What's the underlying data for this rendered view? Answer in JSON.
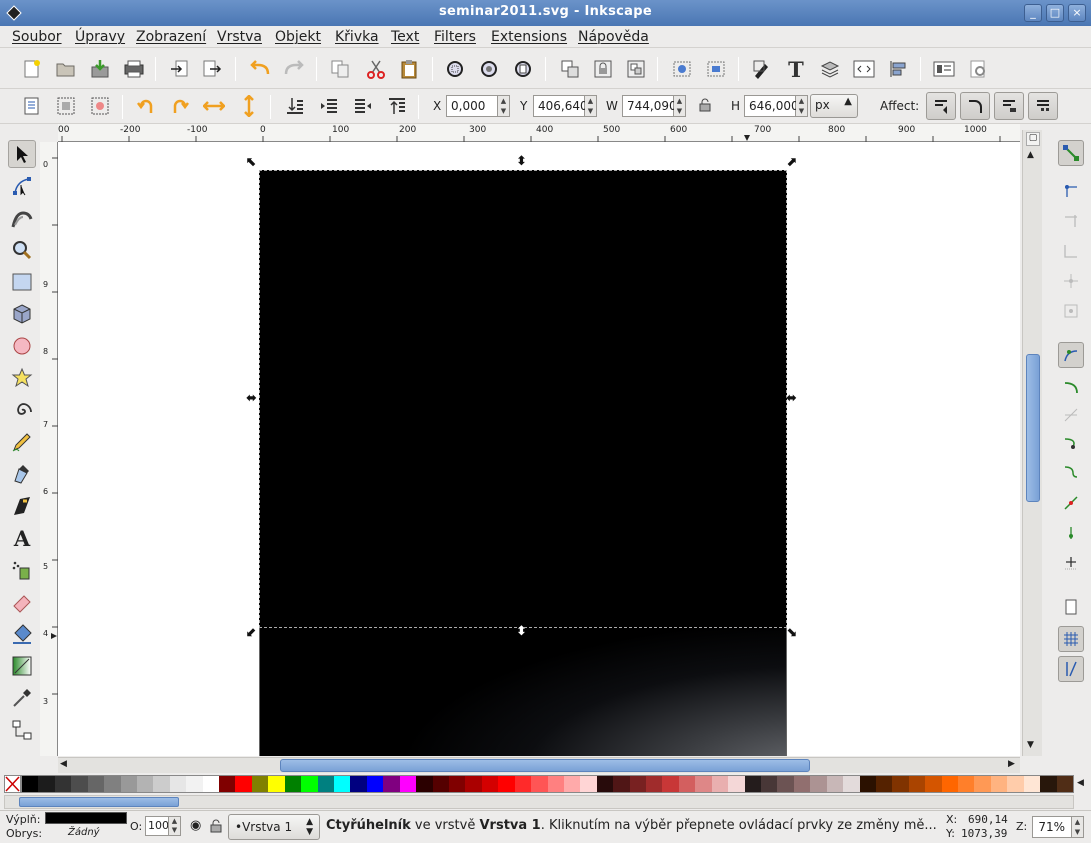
{
  "window": {
    "title": "seminar2011.svg - Inkscape",
    "btn_min": "_",
    "btn_max": "□",
    "btn_close": "×"
  },
  "menu": [
    "Soubor",
    "Úpravy",
    "Zobrazení",
    "Vrstva",
    "Objekt",
    "Křivka",
    "Text",
    "Filters",
    "Extensions",
    "Nápověda"
  ],
  "toolcontrols": {
    "x_label": "X",
    "x_value": "0,000",
    "y_label": "Y",
    "y_value": "406,640",
    "w_label": "W",
    "w_value": "744,090",
    "h_label": "H",
    "h_value": "646,000",
    "unit": "px",
    "affect_label": "Affect:"
  },
  "ruler": {
    "h_ticks": [
      "00",
      "-200",
      "-100",
      "0",
      "100",
      "200",
      "300",
      "400",
      "500",
      "600",
      "700",
      "800",
      "900",
      "1000"
    ],
    "v_ticks": [
      "0",
      "9",
      "8",
      "7",
      "6",
      "5",
      "4",
      "3"
    ]
  },
  "colors": {
    "palette": [
      "#000000",
      "#1c1c1c",
      "#333333",
      "#4d4d4d",
      "#666666",
      "#808080",
      "#999999",
      "#b3b3b3",
      "#cccccc",
      "#e6e6e6",
      "#f2f2f2",
      "#ffffff",
      "#800000",
      "#ff0000",
      "#808000",
      "#ffff00",
      "#008000",
      "#00ff00",
      "#008080",
      "#00ffff",
      "#000080",
      "#0000ff",
      "#800080",
      "#ff00ff",
      "#2b0000",
      "#550000",
      "#800000",
      "#aa0000",
      "#d40000",
      "#ff0000",
      "#ff2a2a",
      "#ff5555",
      "#ff8080",
      "#ffaaaa",
      "#ffd5d5",
      "#280b0b",
      "#501616",
      "#782121",
      "#a02c2c",
      "#c83737",
      "#d35f5f",
      "#de8787",
      "#e9afaf",
      "#f4d7d7",
      "#241c1c",
      "#483737",
      "#6c5353",
      "#916f6f",
      "#ac9393",
      "#c8b7b7",
      "#e3dbdb",
      "#2b1100",
      "#552200",
      "#803300",
      "#aa4400",
      "#d45500",
      "#ff6600",
      "#ff7f2a",
      "#ff9955",
      "#ffb380",
      "#ffccaa",
      "#ffe6d5",
      "#28170b",
      "#502d16"
    ]
  },
  "status": {
    "fill_label": "Výplň:",
    "stroke_label": "Obrys:",
    "stroke_value": "Žádný",
    "opacity_label": "O:",
    "opacity_value": "100",
    "layer_name": "•Vrstva 1",
    "msg_strong1": "Čtyřúhelník",
    "msg_mid": " ve vrstvě ",
    "msg_strong2": "Vrstva 1",
    "msg_rest": ". Kliknutím na výběr přepnete ovládací prvky ze změny mě...",
    "x_label": "X:",
    "x_coord": "690,14",
    "y_label": "Y:",
    "y_coord": "1073,39",
    "zoom_label": "Z:",
    "zoom_value": "71%"
  }
}
